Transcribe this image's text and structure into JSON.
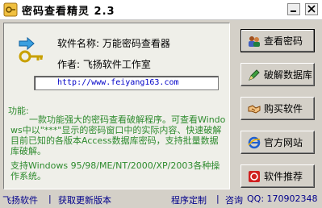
{
  "window": {
    "title": "密码查看精灵 2.3"
  },
  "info": {
    "software_name": "软件名称: 万能密码查看器",
    "author": "作者: 飞扬软件工作室",
    "url": "http://www.feiyang163.com",
    "desc_heading": "功能:",
    "desc_body": "一款功能强大的密码查看破解程序。可查看Windows中以\"***\"显示的密码窗口中的实际内容、快速破解目前已知的各版本Access数据库密码，支持批量数据库破解。",
    "support": "支持Windows 95/98/ME/NT/2000/XP/2003各种操作系统。"
  },
  "buttons": {
    "view_password": "查看密码",
    "crack_database": "破解数据库",
    "buy_software": "购买软件",
    "official_site": "官方网站",
    "recommend": "软件推荐"
  },
  "status": {
    "brand": "飞扬软件",
    "sep": "|",
    "updates": "获取更新版本",
    "custom": "程序定制",
    "consult": "咨询",
    "qq": "QQ: 170902348"
  },
  "colors": {
    "accent_green": "#2e8b2e",
    "link_blue": "#0000c8",
    "status_blue": "#00008b",
    "face": "#d4d0c8"
  }
}
